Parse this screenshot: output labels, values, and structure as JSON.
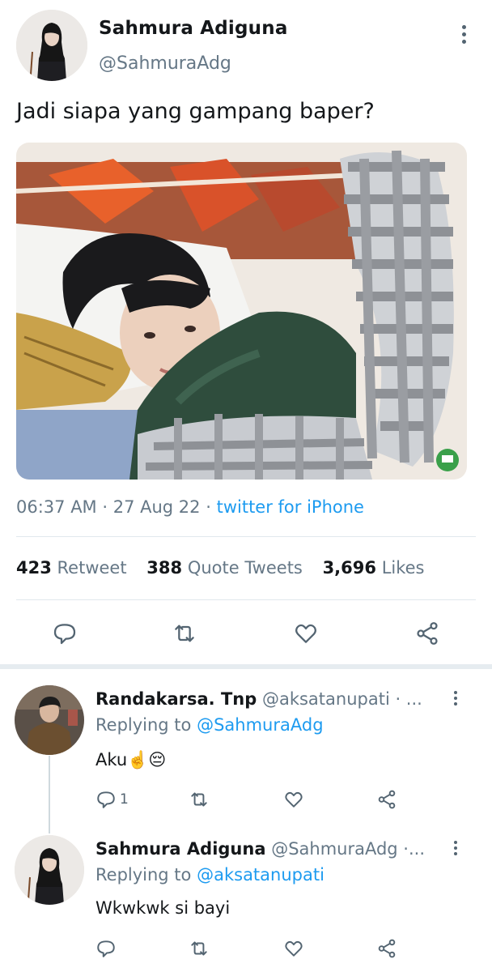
{
  "tweet": {
    "author": {
      "name": "Sahmura Adiguna",
      "handle": "@SahmuraAdg"
    },
    "text": "Jadi siapa yang gampang baper?",
    "time": "06:37 AM",
    "date": "27 Aug 22",
    "source": "twitter for iPhone",
    "stats": {
      "retweets": "423",
      "retweets_label": "Retweet",
      "quotes": "388",
      "quotes_label": "Quote Tweets",
      "likes": "3,696",
      "likes_label": "Likes"
    }
  },
  "replies": [
    {
      "name": "Randakarsa. Tnp",
      "handle": "@aksatanupati · ...",
      "replying_label": "Replying to",
      "replying_to": "@SahmuraAdg",
      "text": "Aku☝️😔",
      "reply_count": "1"
    },
    {
      "name": "Sahmura Adiguna",
      "handle": "@SahmuraAdg ·...",
      "replying_label": "Replying to",
      "replying_to": "@aksatanupati",
      "text": "Wkwkwk si bayi",
      "reply_count": ""
    }
  ],
  "icons": {
    "reply": "speech-bubble-icon",
    "retweet": "retweet-icon",
    "like": "heart-icon",
    "share": "share-icon",
    "more": "three-dots-vertical-icon"
  },
  "colors": {
    "accent": "#1d9bf0",
    "muted": "#657786",
    "text": "#14171a"
  }
}
